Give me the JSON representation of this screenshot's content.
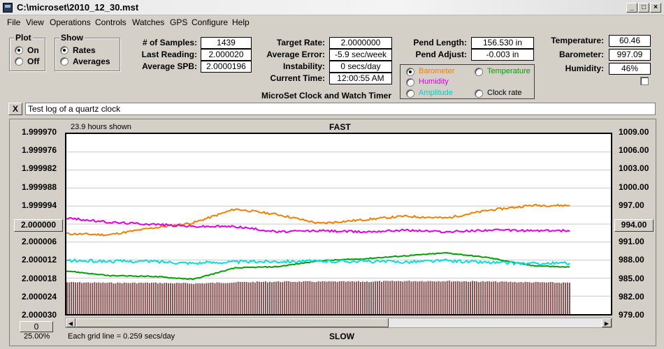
{
  "window": {
    "title": "C:\\microset\\2010_12_30.mst"
  },
  "menu": [
    "File",
    "View",
    "Operations",
    "Controls",
    "Watches",
    "GPS",
    "Configure",
    "Help"
  ],
  "plot_group": {
    "title": "Plot",
    "on": "On",
    "off": "Off"
  },
  "show_group": {
    "title": "Show",
    "rates": "Rates",
    "averages": "Averages"
  },
  "fields": {
    "samples_label": "# of Samples:",
    "samples": "1439",
    "last_label": "Last Reading:",
    "last": "2.000020",
    "avg_spb_label": "Average SPB:",
    "avg_spb": "2.0000196",
    "target_label": "Target Rate:",
    "target": "2.0000000",
    "avg_err_label": "Average Error:",
    "avg_err": "-5.9 sec/week",
    "instab_label": "Instability:",
    "instab": "0 secs/day",
    "time_label": "Current Time:",
    "time": "12:00:55 AM",
    "pend_len_label": "Pend Length:",
    "pend_len": "156.530 in",
    "pend_adj_label": "Pend Adjust:",
    "pend_adj": "-0.003 in",
    "temp_label": "Temperature:",
    "temp": "60.46",
    "baro_label": "Barometer:",
    "baro": "997.09",
    "hum_label": "Humidity:",
    "hum": "46%"
  },
  "subtitle": "MicroSet Clock and Watch Timer",
  "legend": {
    "barometer": "Barometer",
    "temperature": "Temperature",
    "humidity": "Humidity",
    "amplitude": "Amplitude",
    "clock_rate": "Clock rate"
  },
  "note": "Test log of a quartz clock",
  "plot": {
    "hours_shown": "23.9 hours shown",
    "fast": "FAST",
    "slow": "SLOW",
    "grid_note": "Each grid line = 0.259 secs/day",
    "left_button": "2.000000",
    "right_button": "994.00",
    "bottom_left_value": "0",
    "bottom_left_pct": "25.00%"
  },
  "colors": {
    "barometer": "#f08000",
    "temperature": "#00a000",
    "humidity": "#e000e0",
    "amplitude": "#00e0e0",
    "clock_rate": "#7a3e3e"
  },
  "chart_data": {
    "type": "line",
    "title": "",
    "ylabel_left_ticks": [
      "1.999970",
      "1.999976",
      "1.999982",
      "1.999988",
      "1.999994",
      "2.000000",
      "2.000006",
      "2.000012",
      "2.000018",
      "2.000024",
      "2.000030"
    ],
    "ylabel_right_ticks": [
      "1009.00",
      "1006.00",
      "1003.00",
      "1000.00",
      "997.00",
      "994.00",
      "991.00",
      "988.00",
      "985.00",
      "982.00",
      "979.00"
    ],
    "ylim_left": [
      1.99997,
      2.00003
    ],
    "ylim_right": [
      979,
      1009
    ],
    "x_hours": [
      0,
      2,
      4,
      6,
      8,
      10,
      12,
      14,
      16,
      18,
      20,
      22,
      23.9
    ],
    "series": [
      {
        "name": "Barometer",
        "axis": "right",
        "values": [
          992.4,
          992.2,
          993.3,
          994.2,
          996.5,
          995.6,
          994.1,
          994.7,
          995.3,
          995.0,
          996.3,
          997.1,
          997.1
        ]
      },
      {
        "name": "Humidity",
        "axis": "right",
        "values": [
          995.0,
          994.3,
          994.0,
          993.6,
          993.6,
          992.7,
          992.9,
          992.7,
          993.0,
          992.7,
          993.0,
          992.9,
          992.9
        ]
      },
      {
        "name": "Temperature",
        "axis": "right",
        "values": [
          986.2,
          985.4,
          985.3,
          984.8,
          986.7,
          986.9,
          987.9,
          988.2,
          988.7,
          989.2,
          988.4,
          987.1,
          986.8
        ]
      },
      {
        "name": "Amplitude",
        "axis": "right",
        "values": [
          987.9,
          987.8,
          987.8,
          987.5,
          987.7,
          987.8,
          987.8,
          987.8,
          987.7,
          987.9,
          987.6,
          987.4,
          987.5
        ]
      },
      {
        "name": "Clock rate",
        "axis": "left",
        "values": [
          2.0000194,
          2.0000196,
          2.0000196,
          2.0000198,
          2.0000194,
          2.0000192,
          2.0000192,
          2.0000192,
          2.000019,
          2.000019,
          2.0000192,
          2.0000194,
          2.0000196
        ]
      }
    ],
    "grid": true
  }
}
